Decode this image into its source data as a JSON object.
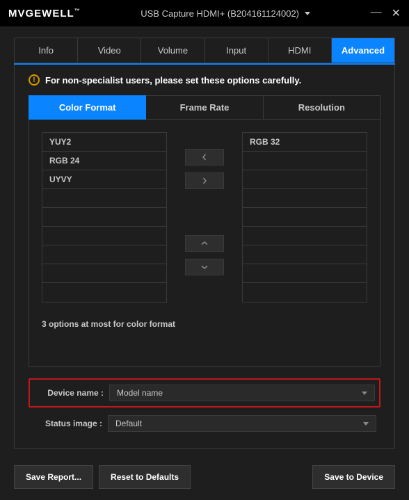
{
  "titlebar": {
    "brand": "MVGEWELL",
    "device": "USB Capture HDMI+ (B204161124002)"
  },
  "tabs": [
    "Info",
    "Video",
    "Volume",
    "Input",
    "HDMI",
    "Advanced"
  ],
  "activeTab": 5,
  "warning": "For non-specialist users, please set these options carefully.",
  "subtabs": [
    "Color Format",
    "Frame Rate",
    "Resolution"
  ],
  "activeSubtab": 0,
  "leftList": [
    "YUY2",
    "RGB 24",
    "UYVY",
    "",
    "",
    "",
    "",
    "",
    ""
  ],
  "rightList": [
    "RGB 32",
    "",
    "",
    "",
    "",
    "",
    "",
    "",
    ""
  ],
  "hint": "3 options at most for color format",
  "form": {
    "deviceNameLabel": "Device name :",
    "deviceNameValue": "Model name",
    "statusImageLabel": "Status image :",
    "statusImageValue": "Default"
  },
  "footer": {
    "saveReport": "Save Report...",
    "reset": "Reset to Defaults",
    "saveDevice": "Save to Device"
  }
}
